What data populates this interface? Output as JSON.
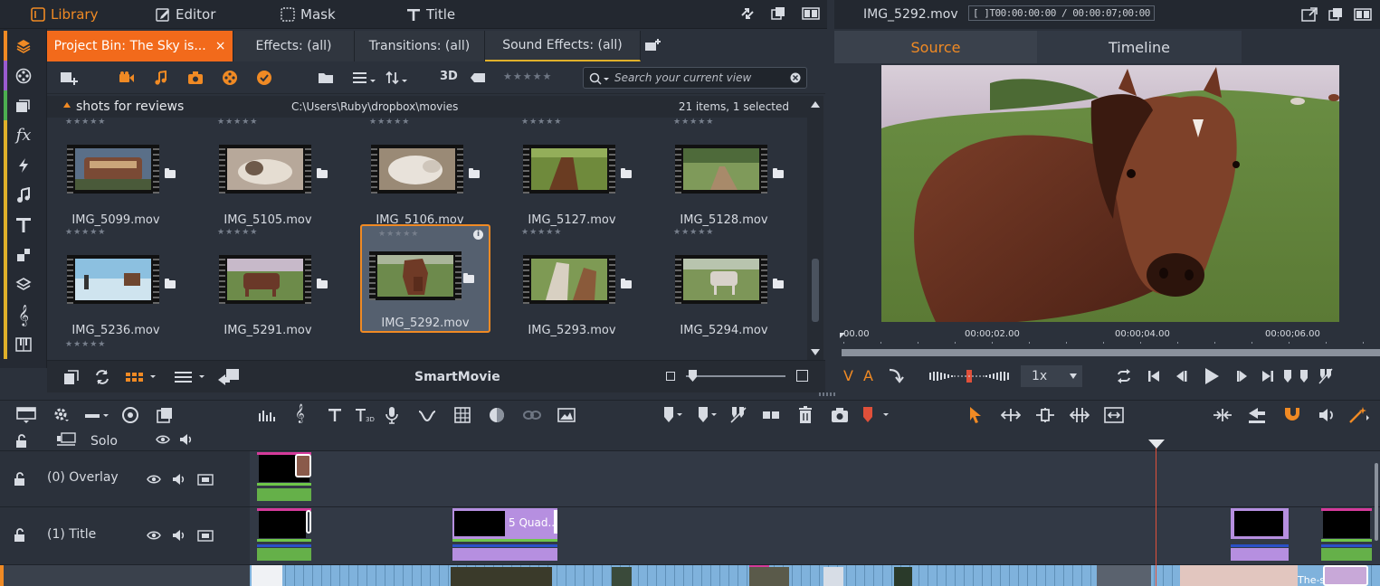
{
  "menu": {
    "library": "Library",
    "editor": "Editor",
    "mask": "Mask",
    "title": "Title"
  },
  "library_tabs": [
    {
      "label": "Project Bin: The Sky is...",
      "close": "×"
    },
    {
      "label": "Effects: (all)"
    },
    {
      "label": "Transitions: (all)"
    },
    {
      "label": "Sound Effects: (all)"
    }
  ],
  "toolbar": {
    "three_d": "3D",
    "search_placeholder": "Search your current view"
  },
  "bin": {
    "name": "shots for reviews",
    "path": "C:\\Users\\Ruby\\dropbox\\movies",
    "status": "21 items, 1 selected"
  },
  "clips": [
    {
      "name": "IMG_5099.mov",
      "stars": "★★★★★"
    },
    {
      "name": "IMG_5105.mov",
      "stars": "★★★★★"
    },
    {
      "name": "IMG_5106.mov",
      "stars": "★★★★★"
    },
    {
      "name": "IMG_5127.mov",
      "stars": "★★★★★"
    },
    {
      "name": "IMG_5128.mov",
      "stars": "★★★★★"
    },
    {
      "name": "IMG_5236.mov",
      "stars": "★★★★★"
    },
    {
      "name": "IMG_5291.mov",
      "stars": "★★★★★"
    },
    {
      "name": "IMG_5292.mov",
      "stars": "★★★★★",
      "selected": true
    },
    {
      "name": "IMG_5293.mov",
      "stars": "★★★★★"
    },
    {
      "name": "IMG_5294.mov",
      "stars": "★★★★★"
    }
  ],
  "row3_stars": "★★★★★",
  "library_bottom": {
    "smartmovie": "SmartMovie",
    "zoom_level": 0.1
  },
  "player": {
    "file": "IMG_5292.mov",
    "timecode": "[ ]T00:00:00:00 / 00:00:07;00:00",
    "tabs": [
      "Source",
      "Timeline"
    ],
    "ruler_ticks": [
      "00.00",
      "00:00;02.00",
      "00:00;04.00",
      "00:00;06.00"
    ],
    "speed": "1x",
    "v_label": "V",
    "a_label": "A"
  },
  "timeline": {
    "solo_label": "Solo",
    "tracks": [
      {
        "name": "(0) Overlay"
      },
      {
        "name": "(1) Title"
      }
    ],
    "title_clip": "5 Quad..",
    "end_clip": "The-sky-is-"
  },
  "colors": {
    "accent": "#f08a24",
    "active_tab": "#f26a1b",
    "clip_green": "#6ec64a",
    "clip_purple": "#b68fe0",
    "clip_blue": "#7fb2dc",
    "playhead": "#e0503a"
  }
}
